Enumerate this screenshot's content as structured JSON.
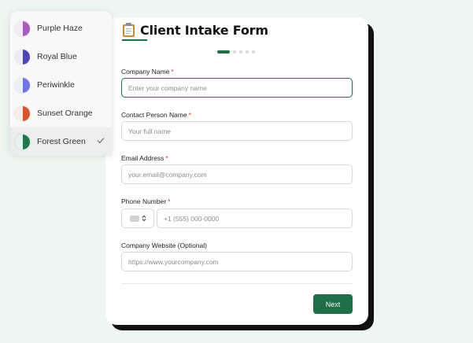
{
  "form": {
    "title": "Client Intake Form",
    "steps_total": 5,
    "active_step": 1,
    "fields": {
      "company_name": {
        "label": "Company Name",
        "required": "*",
        "placeholder": "Enter your company name"
      },
      "contact_person": {
        "label": "Contact Person Name",
        "required": "*",
        "placeholder": "Your full name"
      },
      "email": {
        "label": "Email Address",
        "required": "*",
        "placeholder": "your.email@company.com"
      },
      "phone": {
        "label": "Phone Number",
        "required": "*",
        "placeholder": "+1 (555) 000-0000"
      },
      "website": {
        "label": "Company Website (Optional)",
        "placeholder": "https://www.yourcompany.com"
      }
    },
    "next_label": "Next"
  },
  "theme_menu": {
    "items": [
      {
        "label": "Purple Haze",
        "color": "#a85bbf",
        "light": "#f4e9f7",
        "selected": false
      },
      {
        "label": "Royal Blue",
        "color": "#4f46b5",
        "light": "#ebeaf7",
        "selected": false
      },
      {
        "label": "Periwinkle",
        "color": "#6f74e6",
        "light": "#eceefb",
        "selected": false
      },
      {
        "label": "Sunset Orange",
        "color": "#d4562b",
        "light": "#fbece6",
        "selected": false
      },
      {
        "label": "Forest Green",
        "color": "#1f7a4a",
        "light": "#e6f3ec",
        "selected": true
      }
    ]
  },
  "colors": {
    "accent": "#1f6e45",
    "required": "#d83a3a",
    "card_shadow": "#111111",
    "background": "#eef7f1"
  },
  "icons": {
    "title": "clipboard-icon",
    "selected": "check-icon",
    "country_select": "updown-chevron-icon"
  }
}
